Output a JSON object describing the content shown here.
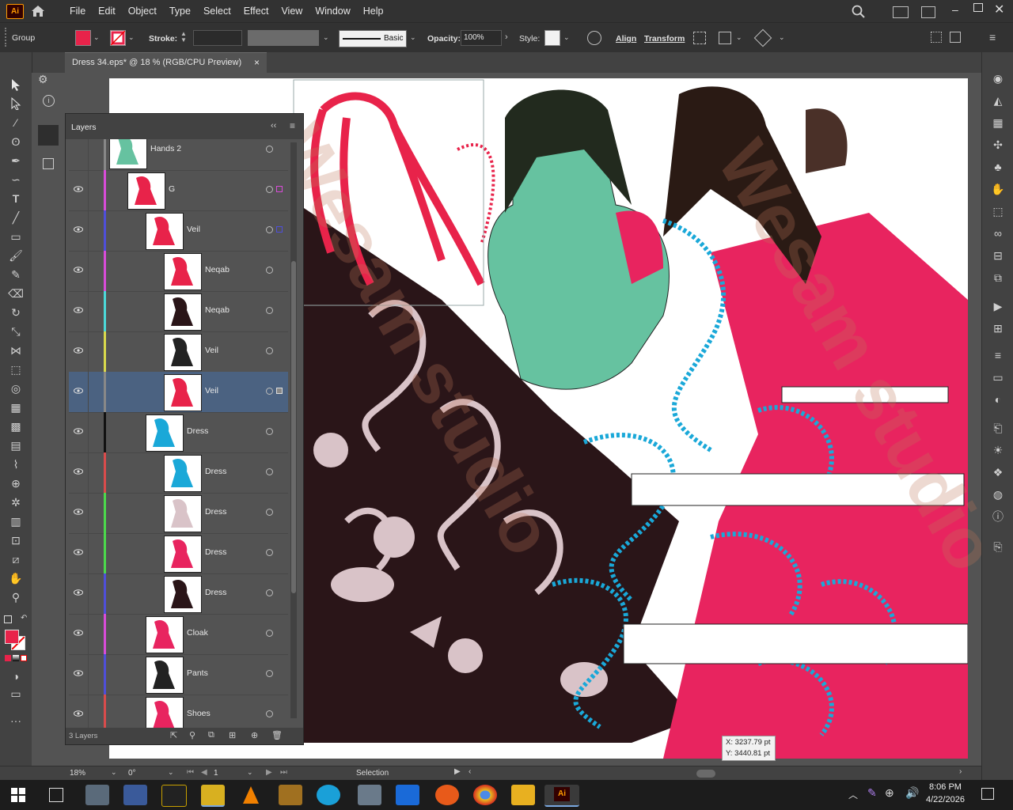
{
  "app": {
    "logo": "Ai"
  },
  "menu": [
    "File",
    "Edit",
    "Object",
    "Type",
    "Select",
    "Effect",
    "View",
    "Window",
    "Help"
  ],
  "control": {
    "selection_type": "Group",
    "fill_color": "#e8234a",
    "stroke_label": "Stroke:",
    "stroke_value": "",
    "brush_label": "Basic",
    "opacity_label": "Opacity:",
    "opacity_value": "100%",
    "style_label": "Style:",
    "align_label": "Align",
    "transform_label": "Transform"
  },
  "document": {
    "tab_title": "Dress 34.eps* @ 18 % (RGB/CPU Preview)",
    "close": "×"
  },
  "layers_panel": {
    "title": "Layers",
    "footer_count": "3 Layers",
    "rows": [
      {
        "name": "Hands 2",
        "stripe": "#888888"
      },
      {
        "name": "G",
        "stripe": "#d94cd9"
      },
      {
        "name": "Veil",
        "stripe": "#4f4fd9"
      },
      {
        "name": "Neqab",
        "stripe": "#d94cd9"
      },
      {
        "name": "Neqab",
        "stripe": "#4cd9d9"
      },
      {
        "name": "Veil",
        "stripe": "#d9d94c"
      },
      {
        "name": "Veil",
        "stripe": "#888888",
        "selected": true
      },
      {
        "name": "Dress",
        "stripe": "#111111"
      },
      {
        "name": "Dress",
        "stripe": "#d94c4c"
      },
      {
        "name": "Dress",
        "stripe": "#4cd94c"
      },
      {
        "name": "Dress",
        "stripe": "#4cd94c"
      },
      {
        "name": "Dress",
        "stripe": "#4f4fd9"
      },
      {
        "name": "Cloak",
        "stripe": "#d94cd9"
      },
      {
        "name": "Pants",
        "stripe": "#4f4fd9"
      },
      {
        "name": "Shoes",
        "stripe": "#d94c4c"
      }
    ]
  },
  "cursor_readout": {
    "x": "X: 3237.79 pt",
    "y": "Y: 3440.81 pt"
  },
  "statusbar": {
    "zoom": "18%",
    "rotation": "0°",
    "artboard": "1",
    "tool": "Selection"
  },
  "taskbar": {
    "time": "8:06 PM",
    "date": "4/22/2026"
  },
  "watermark": "Wesam studio"
}
